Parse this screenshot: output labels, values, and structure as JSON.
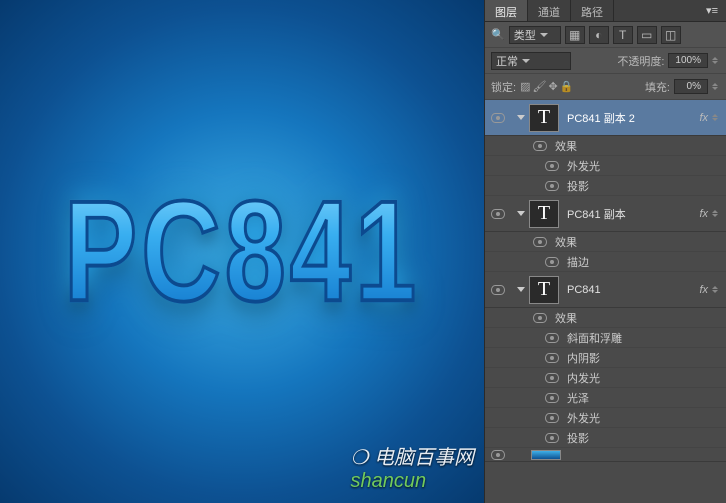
{
  "canvas": {
    "text": "PC841",
    "watermark_prefix": "电脑百事网",
    "watermark_site": "shancun"
  },
  "tabs": {
    "layers": "图层",
    "channels": "通道",
    "paths": "路径"
  },
  "filter_row": {
    "kind": "类型"
  },
  "blend_row": {
    "mode": "正常",
    "opacity_label": "不透明度:",
    "opacity_value": "100%"
  },
  "lock_row": {
    "lock_label": "锁定:",
    "fill_label": "填充:",
    "fill_value": "0%"
  },
  "effects_label": "效果",
  "fx_label": "fx",
  "layers_data": [
    {
      "name": "PC841 副本 2",
      "selected": true,
      "effects": [
        "外发光",
        "投影"
      ]
    },
    {
      "name": "PC841 副本",
      "selected": false,
      "effects": [
        "描边"
      ]
    },
    {
      "name": "PC841",
      "selected": false,
      "effects": [
        "斜面和浮雕",
        "内阴影",
        "内发光",
        "光泽",
        "外发光",
        "投影"
      ]
    }
  ]
}
